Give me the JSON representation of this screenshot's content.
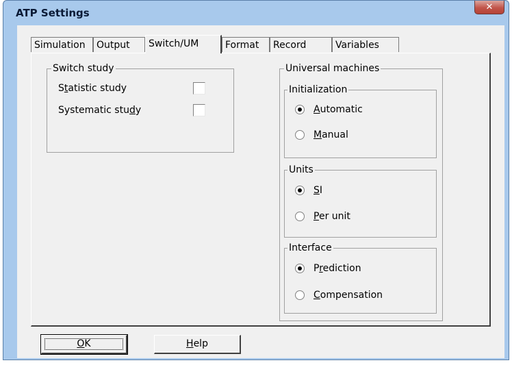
{
  "window": {
    "title": "ATP Settings",
    "close_glyph": "✕"
  },
  "tabs": [
    {
      "label": "Simulation",
      "selected": false
    },
    {
      "label": "Output",
      "selected": false
    },
    {
      "label": "Switch/UM",
      "selected": true
    },
    {
      "label": "Format",
      "selected": false
    },
    {
      "label": "Record",
      "selected": false
    },
    {
      "label": "Variables",
      "selected": false
    }
  ],
  "switch_study": {
    "title": "Switch study",
    "statistic": {
      "label_pre": "S",
      "label_u": "t",
      "label_post": "atistic study",
      "checked": false
    },
    "systematic": {
      "label_pre": "Systematic stu",
      "label_u": "d",
      "label_post": "y",
      "checked": false
    }
  },
  "universal_machines": {
    "title": "Universal machines",
    "initialization": {
      "title": "Initialization",
      "automatic": {
        "label_u": "A",
        "label_post": "utomatic",
        "selected": true
      },
      "manual": {
        "label_u": "M",
        "label_post": "anual",
        "selected": false
      }
    },
    "units": {
      "title": "Units",
      "si": {
        "label_u": "S",
        "label_post": "I",
        "selected": true
      },
      "per_unit": {
        "label_u": "P",
        "label_post": "er unit",
        "selected": false
      }
    },
    "interface": {
      "title": "Interface",
      "prediction": {
        "label_pre": "P",
        "label_u": "r",
        "label_post": "ediction",
        "selected": true
      },
      "compensation": {
        "label_u": "C",
        "label_post": "ompensation",
        "selected": false
      }
    }
  },
  "buttons": {
    "ok": {
      "label_u": "O",
      "label_post": "K"
    },
    "help": {
      "label_u": "H",
      "label_post": "elp"
    }
  }
}
